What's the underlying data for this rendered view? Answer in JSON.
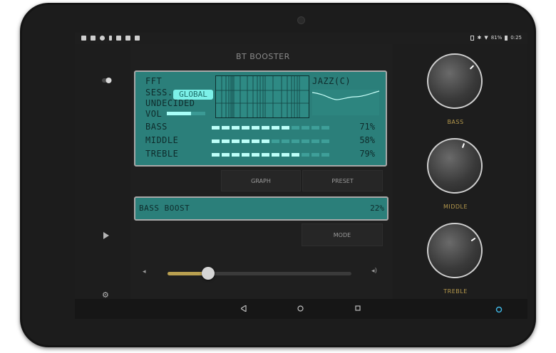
{
  "status_bar": {
    "battery": "81%",
    "time": "0:25"
  },
  "app": {
    "title": "BT BOOSTER"
  },
  "display": {
    "row1": "FFT",
    "row2_label": "SESS.",
    "session_mode": "GLOBAL",
    "row3": "UNDECIDED",
    "row4": "VOL",
    "preset": "JAZZ(C)",
    "volume_level": 0.62,
    "channels": [
      {
        "name": "BASS",
        "percent": "71%",
        "level": 0.71
      },
      {
        "name": "MIDDLE",
        "percent": "58%",
        "level": 0.58
      },
      {
        "name": "TREBLE",
        "percent": "79%",
        "level": 0.79
      }
    ]
  },
  "buttons": {
    "graph": "GRAPH",
    "preset": "PRESET",
    "mode": "MODE"
  },
  "boost": {
    "label": "BASS BOOST",
    "percent": "22%",
    "level": 0.22
  },
  "volume_slider": {
    "level": 0.22
  },
  "knobs": [
    {
      "label": "BASS"
    },
    {
      "label": "MIDDLE"
    },
    {
      "label": "TREBLE"
    }
  ],
  "icons": {
    "left": [
      "toggle-icon",
      "play-icon",
      "settings-icon"
    ],
    "nav": [
      "back-icon",
      "home-icon",
      "recents-icon"
    ],
    "volume_low": "volume-low-icon",
    "volume_high": "volume-high-icon"
  },
  "colors": {
    "lcd": "#2b7f7a",
    "lcd_text": "#0e2b2b",
    "lcd_bright": "#bdfff9",
    "accent_gold": "#b79a4d"
  }
}
